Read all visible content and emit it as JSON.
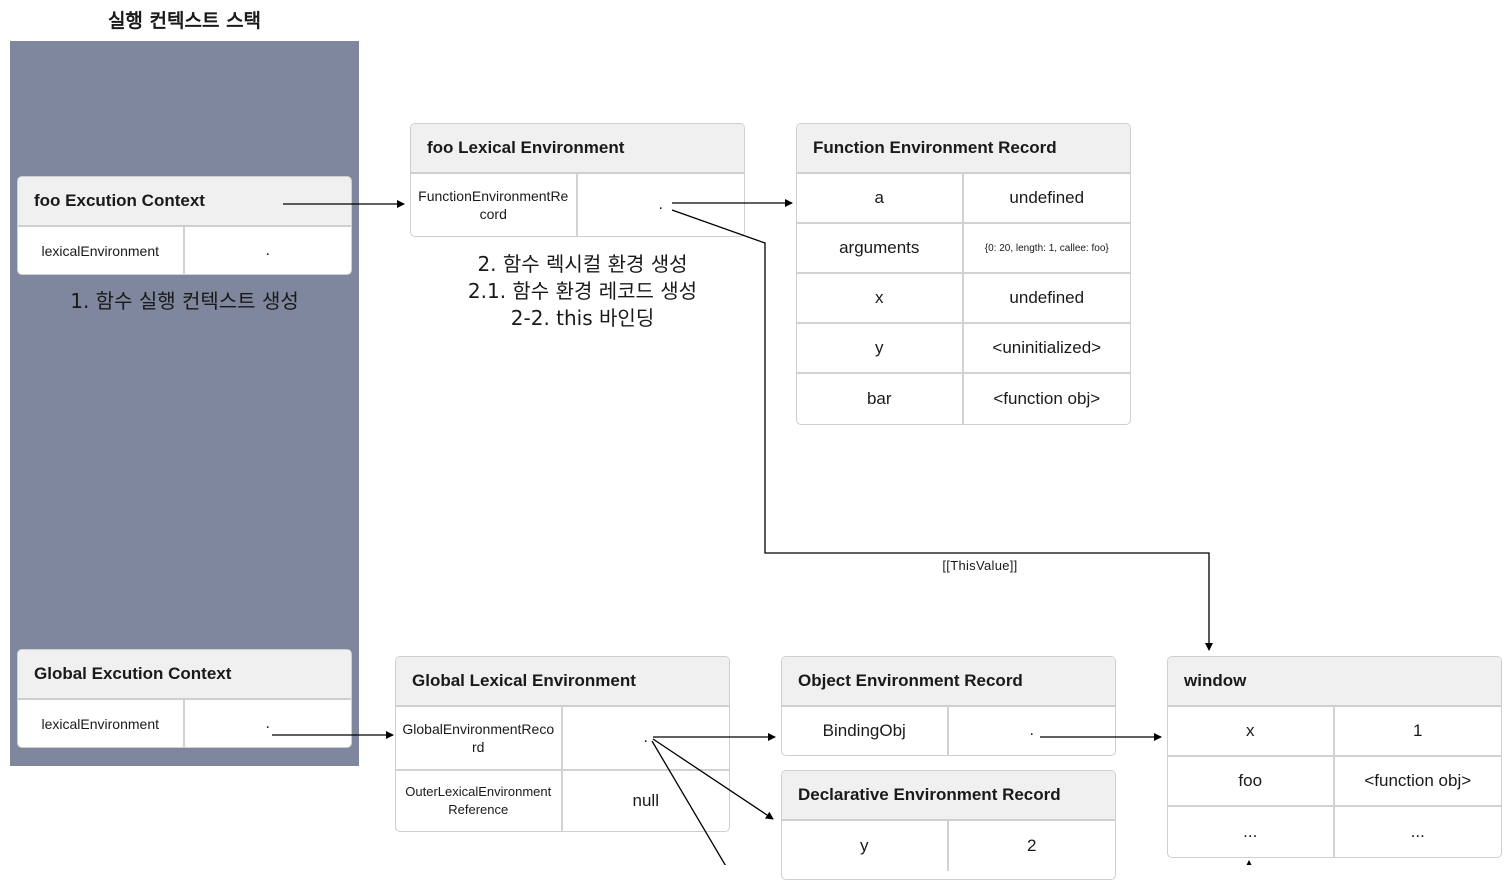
{
  "stack": {
    "title": "실행 컨텍스트 스택",
    "caption": "1. 함수 실행 컨텍스트 생성"
  },
  "foo_ec": {
    "title": "foo Excution Context",
    "rows": [
      {
        "key": "lexicalEnvironment",
        "value": "."
      }
    ]
  },
  "global_ec": {
    "title": "Global Excution Context",
    "rows": [
      {
        "key": "lexicalEnvironment",
        "value": "."
      }
    ]
  },
  "foo_le": {
    "title": "foo Lexical Environment",
    "rows": [
      {
        "key": "FunctionEnvironmentRecord",
        "value": "."
      }
    ],
    "captions": [
      "2. 함수 렉시컬 환경 생성",
      "2.1. 함수 환경 레코드 생성",
      "2-2. this 바인딩"
    ]
  },
  "fer": {
    "title": "Function Environment Record",
    "rows": [
      {
        "key": "a",
        "value": "undefined"
      },
      {
        "key": "arguments",
        "value": "{0: 20, length: 1, callee: foo}"
      },
      {
        "key": "x",
        "value": "undefined"
      },
      {
        "key": "y",
        "value": "<uninitialized>"
      },
      {
        "key": "bar",
        "value": "<function obj>"
      }
    ]
  },
  "this_label": "[[ThisValue]]",
  "global_le": {
    "title": "Global Lexical Environment",
    "rows": [
      {
        "key": "GlobalEnvironmentRecord",
        "value": "."
      },
      {
        "key": "OuterLexicalEnvironmentReference",
        "value": "null"
      }
    ]
  },
  "oer": {
    "title": "Object Environment Record",
    "rows": [
      {
        "key": "BindingObj",
        "value": "."
      }
    ]
  },
  "der": {
    "title": "Declarative Environment Record",
    "rows": [
      {
        "key": "y",
        "value": "2"
      }
    ]
  },
  "window": {
    "title": "window",
    "rows": [
      {
        "key": "x",
        "value": "1"
      },
      {
        "key": "foo",
        "value": "<function obj>"
      },
      {
        "key": "...",
        "value": "..."
      }
    ]
  },
  "colors": {
    "stack_bg": "#7f879e",
    "header_bg": "#f0f0f0",
    "border": "#cfcfcf",
    "arrow": "#000000"
  }
}
